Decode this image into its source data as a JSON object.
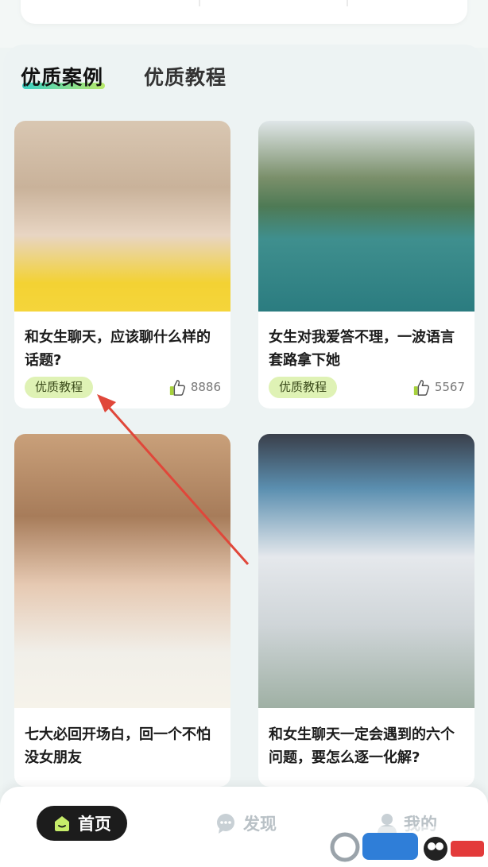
{
  "tabs": [
    {
      "label": "优质案例",
      "active": true
    },
    {
      "label": "优质教程",
      "active": false
    }
  ],
  "cards": [
    {
      "title": "和女生聊天，应该聊什么样的话题?",
      "badge": "优质教程",
      "likes": "8886"
    },
    {
      "title": "女生对我爱答不理，一波语言套路拿下她",
      "badge": "优质教程",
      "likes": "5567"
    },
    {
      "title": "七大必回开场白，回一个不怕没女朋友",
      "badge": "",
      "likes": ""
    },
    {
      "title": "和女生聊天一定会遇到的六个问题，要怎么逐一化解?",
      "badge": "",
      "likes": ""
    }
  ],
  "bottom_nav": {
    "home": "首页",
    "discover": "发现",
    "mine": "我的"
  },
  "colors": {
    "accent_gradient_start": "#3ad0c4",
    "accent_gradient_end": "#b8e86a",
    "badge_bg": "#dff2b5",
    "arrow": "#e0473a"
  },
  "watermark_icon": "site-logo-watermark"
}
